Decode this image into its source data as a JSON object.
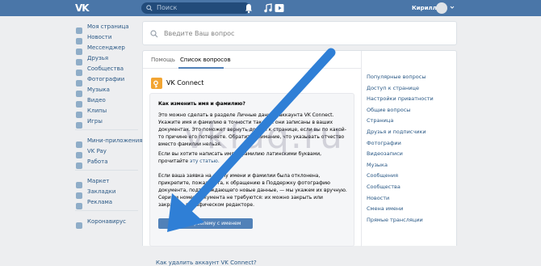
{
  "topbar": {
    "logo": "VK",
    "search_placeholder": "Поиск",
    "user_name": "Кирилл"
  },
  "sidebar": {
    "groups": [
      [
        {
          "label": "Моя страница",
          "icon": "home-icon"
        },
        {
          "label": "Новости",
          "icon": "news-icon"
        },
        {
          "label": "Мессенджер",
          "icon": "messenger-icon"
        },
        {
          "label": "Друзья",
          "icon": "friends-icon"
        },
        {
          "label": "Сообщества",
          "icon": "communities-icon"
        },
        {
          "label": "Фотографии",
          "icon": "photo-icon"
        },
        {
          "label": "Музыка",
          "icon": "music-icon"
        },
        {
          "label": "Видео",
          "icon": "video-icon"
        },
        {
          "label": "Клипы",
          "icon": "clips-icon"
        },
        {
          "label": "Игры",
          "icon": "games-icon"
        }
      ],
      [
        {
          "label": "Мини-приложения",
          "icon": "apps-icon"
        },
        {
          "label": "VK Pay",
          "icon": "vkpay-icon"
        },
        {
          "label": "Работа",
          "icon": "work-icon"
        }
      ],
      [
        {
          "label": "Маркет",
          "icon": "market-icon"
        },
        {
          "label": "Закладки",
          "icon": "bookmarks-icon"
        },
        {
          "label": "Реклама",
          "icon": "ads-icon"
        }
      ],
      [
        {
          "label": "Коронавирус",
          "icon": "coronavirus-icon"
        }
      ]
    ]
  },
  "question_search": {
    "placeholder": "Введите Ваш вопрос"
  },
  "tabs": [
    "Помощь",
    "Список вопросов"
  ],
  "section": {
    "title": "VK Connect",
    "question": "Как изменить имя и фамилию?",
    "para1": "Это можно сделать в разделе Личные данные аккаунта VK Connect. Укажите имя и фамилию в точности так, как они записаны в ваших документах. Это поможет вернуть доступ к странице, если вы по какой-то причине его потеряете. Обратите внимание, что указывать отчество вместо фамилии нельзя.",
    "para2_text": "Если вы хотите написать имя и фамилию латинскими буквами, прочитайте",
    "para2_link": "эту статью.",
    "para3": "Если ваша заявка на смену имени и фамилии была отклонена, прикрепите, пожалуйста, к обращению в Поддержку фотографию документа, подтверждающего новые данные, — мы укажем их вручную. Серия и номер документа не требуются: их можно закрыть или закрасить в графическом редакторе.",
    "button": "Решить проблему с именем",
    "next_question": "Как удалить аккаунт VK Connect?"
  },
  "right_list": [
    "Популярные вопросы",
    "Доступ к странице",
    "Настройки приватности",
    "Общие вопросы",
    "Страница",
    "Друзья и подписчики",
    "Фотографии",
    "Видеозаписи",
    "Музыка",
    "Сообщения",
    "Сообщества",
    "Новости",
    "Смена имени",
    "Прямые трансляции"
  ],
  "watermark": "vkfaq.ru",
  "colors": {
    "header": "#4a76a8",
    "link": "#2a5885",
    "button": "#5181b8",
    "arrow": "#2f7fd6"
  }
}
